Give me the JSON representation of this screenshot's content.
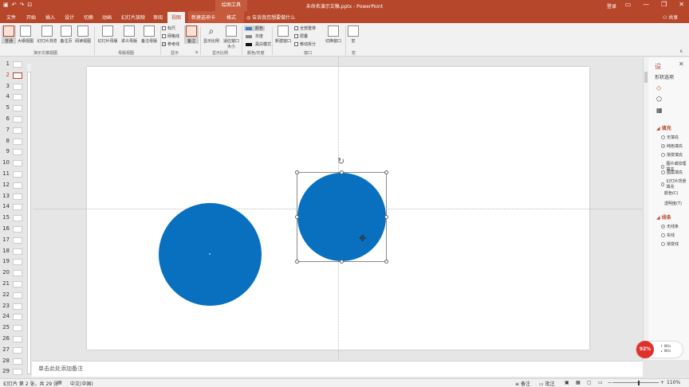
{
  "title_bar": {
    "document_title": "未命名演示文稿.pptx - PowerPoint",
    "context_tool": "绘图工具",
    "signin": "登录",
    "window_controls": [
      "▭",
      "—",
      "❐",
      "✕"
    ],
    "qat_icons": [
      "save-icon",
      "undo-icon",
      "redo-icon",
      "slideshow-icon"
    ]
  },
  "tabs": {
    "items": [
      "文件",
      "开始",
      "插入",
      "设计",
      "切换",
      "动画",
      "幻灯片放映",
      "审阅",
      "视图",
      "新建选项卡",
      "格式"
    ],
    "active": "视图",
    "search": "告诉我您想要做什么",
    "share": "共享"
  },
  "ribbon": {
    "presentation_views": {
      "buttons": [
        "普通",
        "大纲视图",
        "幻灯片浏览",
        "备注页",
        "阅读视图"
      ],
      "label": "演示文稿视图"
    },
    "master_views": {
      "buttons": [
        "幻灯片母版",
        "讲义母版",
        "备注母版"
      ],
      "label": "母版视图"
    },
    "show": {
      "checks": [
        {
          "label": "标尺",
          "checked": false
        },
        {
          "label": "网格线",
          "checked": false
        },
        {
          "label": "参考线",
          "checked": true
        }
      ],
      "label": "显示"
    },
    "notes_button": "备注",
    "zoom": {
      "buttons": [
        "显示比例",
        "适应窗口大小"
      ],
      "label": "显示比例"
    },
    "color": {
      "items": [
        "颜色",
        "灰度",
        "黑白模式"
      ],
      "label": "颜色/灰度"
    },
    "window": {
      "buttons": [
        "新建窗口",
        "全部重排",
        "层叠",
        "移动拆分",
        "切换窗口"
      ],
      "label": "窗口"
    },
    "macro": {
      "button": "宏",
      "label": "宏"
    }
  },
  "thumbnails": {
    "numbers": [
      "1",
      "2",
      "3",
      "4",
      "5",
      "6",
      "7",
      "8",
      "9",
      "10",
      "11",
      "12",
      "13",
      "14",
      "15",
      "16",
      "17",
      "18",
      "19",
      "20",
      "21",
      "22",
      "23",
      "24",
      "25",
      "26",
      "27",
      "28",
      "29"
    ],
    "active_slide": "2"
  },
  "slide": {
    "shape_color": "#0870bf",
    "guides_visible": true
  },
  "format_pane": {
    "title": "形状选项",
    "fill_section": "填充",
    "fill_options": [
      {
        "label": "无填充",
        "selected": false
      },
      {
        "label": "纯色填充",
        "selected": true
      },
      {
        "label": "渐变填充",
        "selected": false
      },
      {
        "label": "图片或纹理填充",
        "selected": false
      },
      {
        "label": "图案填充",
        "selected": false
      },
      {
        "label": "幻灯片背景填充",
        "selected": false
      }
    ],
    "color_label": "颜色(C)",
    "transparency_label": "透明度(T)",
    "line_section": "线条",
    "line_options": [
      {
        "label": "无线条",
        "selected": true
      },
      {
        "label": "实线",
        "selected": false
      },
      {
        "label": "渐变线",
        "selected": false
      }
    ]
  },
  "notes": {
    "placeholder": "单击此处添加备注"
  },
  "status_bar": {
    "slide_info": "幻灯片 第 2 张，共 29 张",
    "language": "中文(中国)",
    "notes": "备注",
    "comments": "批注",
    "zoom": "110%"
  },
  "badge": {
    "percent": "92%",
    "upload": "↑ 0K/s",
    "download": "↓ 0K/s"
  }
}
